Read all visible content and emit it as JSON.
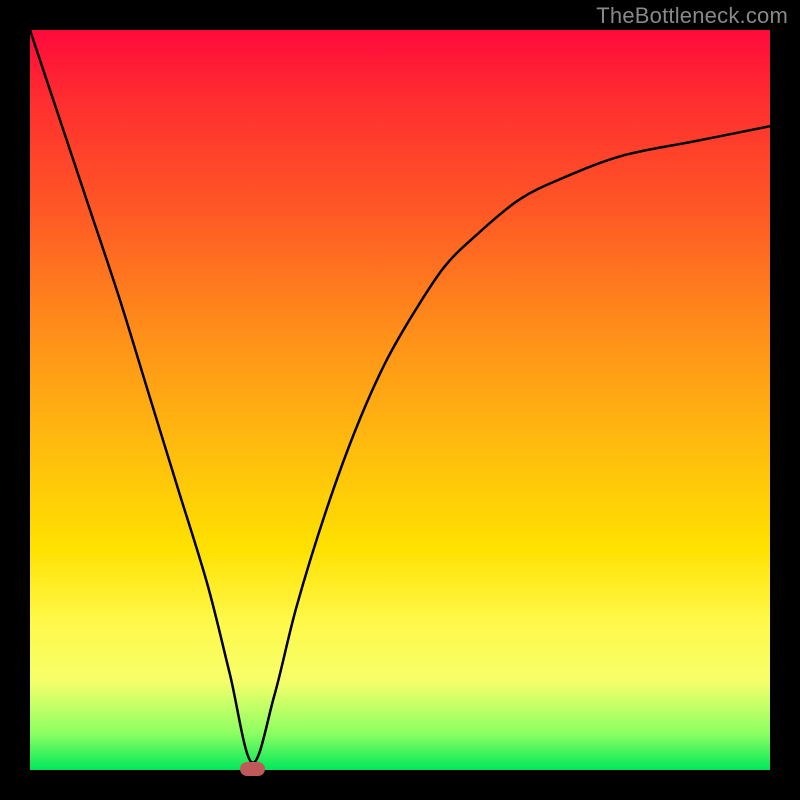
{
  "watermark": {
    "text": "TheBottleneck.com"
  },
  "chart_data": {
    "type": "line",
    "title": "",
    "xlabel": "",
    "ylabel": "",
    "xlim": [
      0,
      100
    ],
    "ylim": [
      0,
      100
    ],
    "grid": false,
    "legend": false,
    "gradient_background": {
      "direction": "vertical",
      "colors": [
        "#ff0a3b",
        "#ff8c1a",
        "#ffe100",
        "#00e85a"
      ],
      "meaning": "red=high bottleneck, green=no bottleneck"
    },
    "series": [
      {
        "name": "bottleneck-curve",
        "x": [
          0,
          4,
          8,
          12,
          16,
          20,
          24,
          27,
          30,
          33,
          36,
          40,
          44,
          48,
          52,
          56,
          60,
          66,
          72,
          80,
          90,
          100
        ],
        "values": [
          100,
          88,
          76,
          64,
          51,
          38,
          25,
          13,
          1,
          10,
          22,
          35,
          46,
          55,
          62,
          68,
          72,
          77,
          80,
          83,
          85,
          87
        ]
      }
    ],
    "markers": [
      {
        "name": "optimal-point",
        "x": 30,
        "y": 0,
        "color": "#c05a5a"
      }
    ]
  }
}
